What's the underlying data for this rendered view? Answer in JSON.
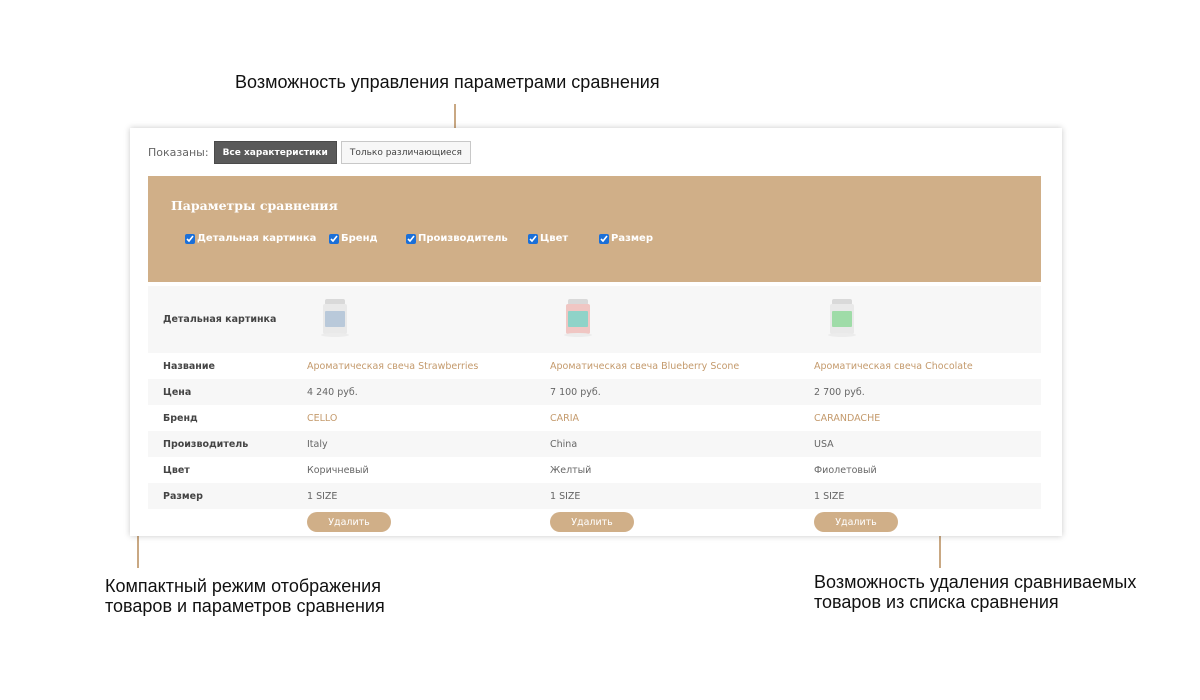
{
  "annotations": {
    "top": "Возможность управления параметрами сравнения",
    "left_line1": "Компактный режим отображения",
    "left_line2": "товаров и параметров сравнения",
    "right_line1": "Возможность удаления сравниваемых",
    "right_line2": "товаров из списка сравнения",
    "accent_color": "#c9a883"
  },
  "filter": {
    "label": "Показаны:",
    "tabs": [
      {
        "label": "Все характеристики",
        "active": true
      },
      {
        "label": "Только различающиеся",
        "active": false
      }
    ]
  },
  "params": {
    "title": "Параметры сравнения",
    "panel_color": "#d0af88",
    "options": [
      {
        "label": "Детальная картинка",
        "checked": true
      },
      {
        "label": "Бренд",
        "checked": true
      },
      {
        "label": "Производитель",
        "checked": true
      },
      {
        "label": "Цвет",
        "checked": true
      },
      {
        "label": "Размер",
        "checked": true
      }
    ]
  },
  "table": {
    "labels": {
      "image": "Детальная картинка",
      "name": "Название",
      "price": "Цена",
      "brand": "Бренд",
      "maker": "Производитель",
      "color": "Цвет",
      "size": "Размер"
    },
    "products": [
      {
        "image_icon": "candle-jar-blue-icon",
        "image_color": "#b9c9da",
        "name": "Ароматическая свеча Strawberries",
        "price": "4 240 руб.",
        "brand": "CELLO",
        "maker": "Italy",
        "color": "Коричневый",
        "size": "1 SIZE",
        "delete_label": "Удалить"
      },
      {
        "image_icon": "candle-jar-teal-icon",
        "image_color": "#8fd3c8",
        "name": "Ароматическая свеча Blueberry Scone",
        "price": "7 100 руб.",
        "brand": "CARIA",
        "maker": "China",
        "color": "Желтый",
        "size": "1 SIZE",
        "delete_label": "Удалить"
      },
      {
        "image_icon": "candle-jar-green-icon",
        "image_color": "#9fdca8",
        "name": "Ароматическая свеча Chocolate",
        "price": "2 700 руб.",
        "brand": "CARANDACHE",
        "maker": "USA",
        "color": "Фиолетовый",
        "size": "1 SIZE",
        "delete_label": "Удалить"
      }
    ]
  }
}
